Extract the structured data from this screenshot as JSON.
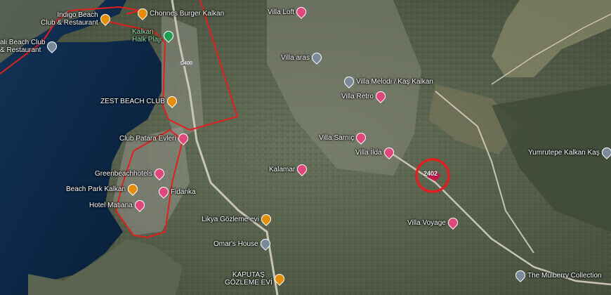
{
  "colors": {
    "sea": "#0e2b4a",
    "land": "#5a6650",
    "boundary": "#e0201e",
    "poi_pink": "#e0457b",
    "poi_orange": "#e58e0c",
    "poi_gray": "#7b8a99"
  },
  "road": {
    "label": "D400"
  },
  "highlight": {
    "label": "2402"
  },
  "pois": [
    {
      "id": "indigo-beach",
      "label": "Indigo Beach\nClub & Restaurant",
      "icon": "orange",
      "side": "left"
    },
    {
      "id": "chonnes-burger",
      "label": "Chonnes Burger Kalkan",
      "icon": "orange",
      "side": "right"
    },
    {
      "id": "bali-beach",
      "label": "ali Beach Club\n& Restaurant",
      "icon": "gray",
      "side": "left"
    },
    {
      "id": "kalkan-halk-plaji",
      "label": "Kalkan\nHalk Plajı",
      "icon": "green",
      "side": "left"
    },
    {
      "id": "zest-beach",
      "label": "ZEST BEACH CLUB",
      "icon": "orange",
      "side": "left"
    },
    {
      "id": "club-patara",
      "label": "Club Patara Evleri",
      "icon": "pink",
      "side": "left"
    },
    {
      "id": "greenbeach",
      "label": "Greenbeachhotels",
      "icon": "pink",
      "side": "left"
    },
    {
      "id": "beach-park",
      "label": "Beach Park Kalkan",
      "icon": "orange",
      "side": "left"
    },
    {
      "id": "hotel-matiana",
      "label": "Hotel Matiana",
      "icon": "pink",
      "side": "left"
    },
    {
      "id": "fidanka",
      "label": "Fidanka",
      "icon": "pink",
      "side": "right"
    },
    {
      "id": "villa-loft",
      "label": "Villa Loft",
      "icon": "pink",
      "side": "left"
    },
    {
      "id": "villa-aras",
      "label": "Villa aras",
      "icon": "gray",
      "side": "left"
    },
    {
      "id": "villa-melodi",
      "label": "Villa Melodi / Kaş Kalkan",
      "icon": "gray",
      "side": "right"
    },
    {
      "id": "villa-retro",
      "label": "Villa Retro",
      "icon": "pink",
      "side": "left"
    },
    {
      "id": "villa-sarnic",
      "label": "Villa Sarnıç",
      "icon": "pink",
      "side": "left"
    },
    {
      "id": "villa-ilda",
      "label": "Villa İlda",
      "icon": "pink",
      "side": "left"
    },
    {
      "id": "kalamar",
      "label": "Kalamar",
      "icon": "pink",
      "side": "left"
    },
    {
      "id": "likya-gozleme",
      "label": "Likya Gözleme evi",
      "icon": "orange",
      "side": "left"
    },
    {
      "id": "omars-house",
      "label": "Omar's House",
      "icon": "gray",
      "side": "left"
    },
    {
      "id": "kaputas-gozleme",
      "label": "KAPUTAŞ\nGÖZLEME EVİ",
      "icon": "orange",
      "side": "left"
    },
    {
      "id": "villa-voyage",
      "label": "Villa Voyage",
      "icon": "pink",
      "side": "left"
    },
    {
      "id": "yumrutepe",
      "label": "Yumrutepe Kalkan Kaş",
      "icon": "gray",
      "side": "left"
    },
    {
      "id": "mulberry",
      "label": "The Mulberry Collection",
      "icon": "gray",
      "side": "right"
    }
  ]
}
